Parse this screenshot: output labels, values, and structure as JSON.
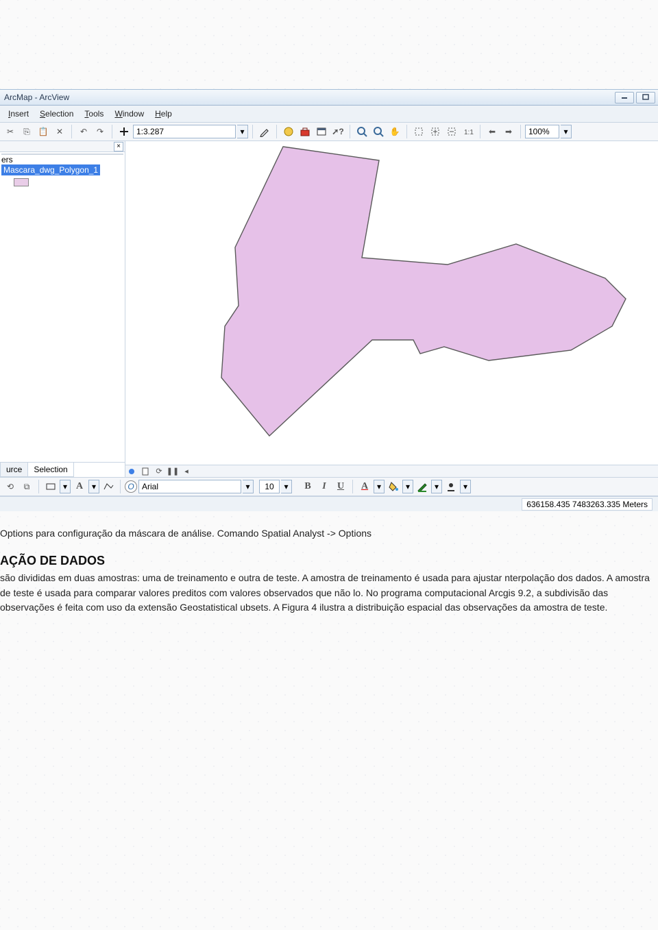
{
  "window": {
    "title": "ArcMap - ArcView"
  },
  "menubar": {
    "insert": "Insert",
    "selection": "Selection",
    "tools": "Tools",
    "window": "Window",
    "help": "Help"
  },
  "toolbar": {
    "scale": "1:3.287",
    "zoom": "100%"
  },
  "toc": {
    "group": "ers",
    "layer": "Mascara_dwg_Polygon_1",
    "tab_source": "urce",
    "tab_selection": "Selection"
  },
  "toolbar2": {
    "font": "Arial",
    "font_size": "10"
  },
  "status": {
    "coords": "636158.435 7483263.335 Meters"
  },
  "doc": {
    "caption": "Options para configuração da máscara de análise. Comando Spatial Analyst -> Options",
    "heading": "AÇÃO DE DADOS",
    "para": "são divididas em duas amostras: uma de treinamento e outra de teste. A amostra de treinamento é usada para ajustar nterpolação dos dados. A amostra de teste é usada para comparar valores preditos com valores observados que não lo. No programa computacional Arcgis 9.2, a subdivisão das observações é feita com uso da extensão Geostatistical ubsets. A Figura 4 ilustra a distribuição espacial das observações da amostra de teste."
  }
}
